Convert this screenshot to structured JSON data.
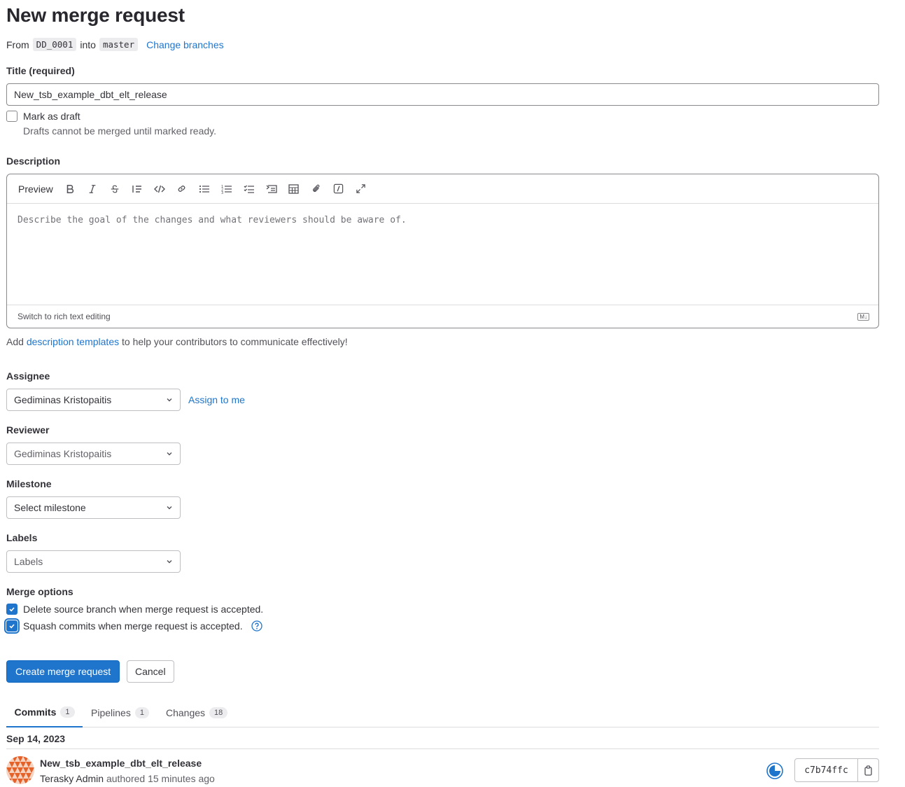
{
  "header": {
    "title": "New merge request",
    "from_label": "From",
    "source_branch": "DD_0001",
    "into_label": "into",
    "target_branch": "master",
    "change_branches": "Change branches"
  },
  "title_field": {
    "label": "Title (required)",
    "value": "New_tsb_example_dbt_elt_release"
  },
  "draft": {
    "label": "Mark as draft",
    "help": "Drafts cannot be merged until marked ready."
  },
  "description": {
    "label": "Description",
    "preview_tab": "Preview",
    "placeholder": "Describe the goal of the changes and what reviewers should be aware of.",
    "switch_rich": "Switch to rich text editing",
    "markdown_badge": "M↓",
    "help_prefix": "Add",
    "help_link": "description templates",
    "help_suffix": "to help your contributors to communicate effectively!",
    "toolbar_icons": [
      "bold-icon",
      "italic-icon",
      "strikethrough-icon",
      "quote-icon",
      "code-icon",
      "link-icon",
      "bullet-list-icon",
      "numbered-list-icon",
      "task-list-icon",
      "collapsible-section-icon",
      "table-icon",
      "attach-file-icon",
      "quick-actions-icon",
      "fullscreen-icon"
    ]
  },
  "assignee": {
    "label": "Assignee",
    "value": "Gediminas Kristopaitis",
    "assign_to_me": "Assign to me"
  },
  "reviewer": {
    "label": "Reviewer",
    "value": "Gediminas Kristopaitis"
  },
  "milestone": {
    "label": "Milestone",
    "value": "Select milestone"
  },
  "labels": {
    "label": "Labels",
    "value": "Labels"
  },
  "merge_options": {
    "label": "Merge options",
    "delete_source": "Delete source branch when merge request is accepted.",
    "squash": "Squash commits when merge request is accepted."
  },
  "actions": {
    "create": "Create merge request",
    "cancel": "Cancel"
  },
  "tabs": [
    {
      "label": "Commits",
      "count": "1"
    },
    {
      "label": "Pipelines",
      "count": "1"
    },
    {
      "label": "Changes",
      "count": "18"
    }
  ],
  "commits": {
    "date": "Sep 14, 2023",
    "items": [
      {
        "title": "New_tsb_example_dbt_elt_release",
        "author": "Terasky Admin",
        "meta": "authored 15 minutes ago",
        "sha": "c7b74ffc"
      }
    ]
  },
  "colors": {
    "accent": "#1f75cb",
    "text": "#333238",
    "avatar": "#e5612a"
  }
}
